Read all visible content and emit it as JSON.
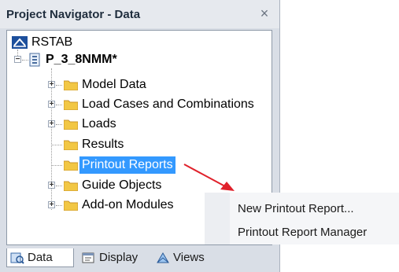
{
  "window": {
    "title": "Project Navigator - Data",
    "close_glyph": "×"
  },
  "tree": {
    "root_label": "RSTAB",
    "project_label": "P_3_8NMM*",
    "items": [
      {
        "label": "Model Data",
        "expandable": true
      },
      {
        "label": "Load Cases and Combinations",
        "expandable": true
      },
      {
        "label": "Loads",
        "expandable": true
      },
      {
        "label": "Results",
        "expandable": false
      },
      {
        "label": "Printout Reports",
        "expandable": false,
        "selected": true
      },
      {
        "label": "Guide Objects",
        "expandable": true
      },
      {
        "label": "Add-on Modules",
        "expandable": true
      }
    ]
  },
  "tabs": [
    {
      "label": "Data",
      "icon": "data-icon",
      "active": true
    },
    {
      "label": "Display",
      "icon": "display-icon",
      "active": false
    },
    {
      "label": "Views",
      "icon": "views-icon",
      "active": false
    }
  ],
  "context_menu": {
    "items": [
      "New Printout Report...",
      "Printout Report Manager"
    ]
  },
  "colors": {
    "selection": "#3399ff",
    "arrow": "#e0212b",
    "folder": "#f2c744"
  }
}
